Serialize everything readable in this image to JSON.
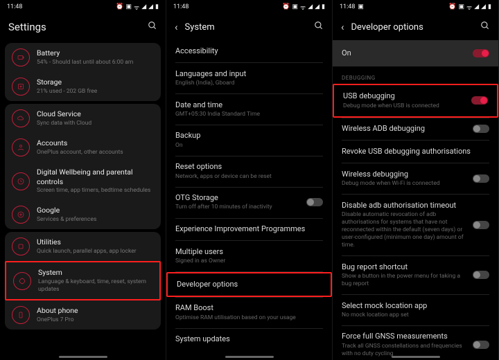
{
  "status": {
    "time": "11:48",
    "icons": [
      "⏰",
      "📶",
      "ᯤ",
      "▮",
      "◢",
      "▮"
    ]
  },
  "p1": {
    "title": "Settings",
    "groups": [
      {
        "items": [
          {
            "icon": "battery",
            "title": "Battery",
            "sub": "54% - Should last until about 6:00 am"
          },
          {
            "icon": "storage",
            "title": "Storage",
            "sub": "21% used - 202 GB free"
          }
        ]
      },
      {
        "items": [
          {
            "icon": "cloud",
            "title": "Cloud Service",
            "sub": "Sync data with Cloud"
          },
          {
            "icon": "account",
            "title": "Accounts",
            "sub": "OnePlus account, other accounts"
          },
          {
            "icon": "wellbeing",
            "title": "Digital Wellbeing and parental controls",
            "sub": "Screen time, app timers, bedtime schedules"
          },
          {
            "icon": "google",
            "title": "Google",
            "sub": "Services & preferences"
          }
        ]
      },
      {
        "items": [
          {
            "icon": "util",
            "title": "Utilities",
            "sub": "Quick launch, parallel apps, app locker"
          },
          {
            "icon": "system",
            "title": "System",
            "sub": "Language & keyboard, time, reset, system updates",
            "hl": true
          },
          {
            "icon": "phone",
            "title": "About phone",
            "sub": "OnePlus 7 Pro"
          }
        ]
      }
    ]
  },
  "p2": {
    "title": "System",
    "items": [
      {
        "title": "Accessibility"
      },
      {
        "title": "Languages and input",
        "sub": "English (India), Gboard"
      },
      {
        "title": "Date and time",
        "sub": "GMT+05:30 India Standard Time"
      },
      {
        "title": "Backup",
        "sub": "On"
      },
      {
        "title": "Reset options",
        "sub": "Network, apps or device can be reset"
      },
      {
        "title": "OTG Storage",
        "sub": "Turn off after 10 minutes of inactivity",
        "toggle": false
      },
      {
        "title": "Experience Improvement Programmes"
      },
      {
        "title": "Multiple users",
        "sub": "Signed in as Owner"
      },
      {
        "title": "Developer options",
        "hl": true
      },
      {
        "title": "RAM Boost",
        "sub": "Optimise RAM utilisation based on your usage"
      },
      {
        "title": "System updates"
      }
    ]
  },
  "p3": {
    "title": "Developer options",
    "on": "On",
    "section": "DEBUGGING",
    "items": [
      {
        "title": "USB debugging",
        "sub": "Debug mode when USB is connected",
        "toggle": true,
        "hl": true
      },
      {
        "title": "Wireless ADB debugging",
        "toggle": false
      },
      {
        "title": "Revoke USB debugging authorisations"
      },
      {
        "title": "Wireless debugging",
        "sub": "Debug mode when Wi-Fi is connected",
        "toggle": false
      },
      {
        "title": "Disable adb authorisation timeout",
        "sub": "Disable automatic revocation of adb authorisations for systems that have not reconnected within the default (seven days) or user-configured (minimum one day) amount of time.",
        "toggle": false
      },
      {
        "title": "Bug report shortcut",
        "sub": "Show a button in the power menu for taking a bug report",
        "toggle": false
      },
      {
        "title": "Select mock location app",
        "sub": "No mock location app set"
      },
      {
        "title": "Force full GNSS measurements",
        "sub": "Track all GNSS constellations and frequencies with no duty cycling",
        "toggle": false
      }
    ]
  }
}
